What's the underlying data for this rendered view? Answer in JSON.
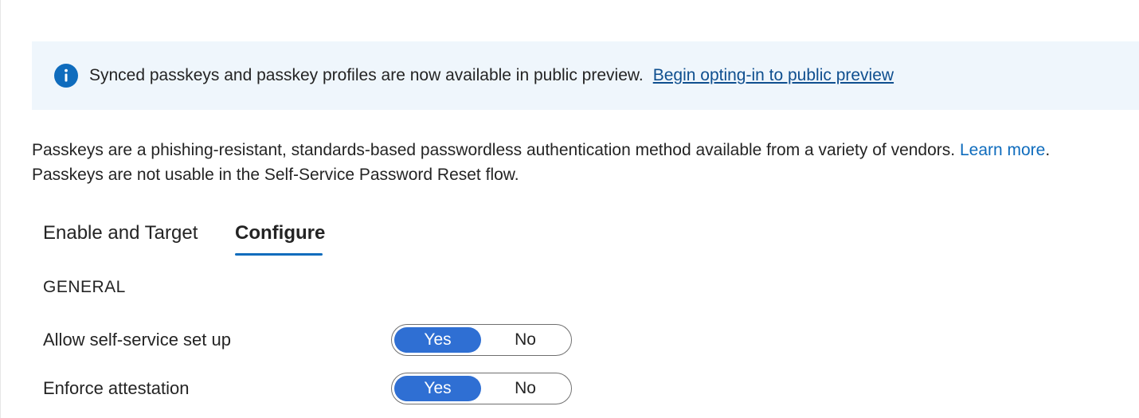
{
  "banner": {
    "icon": "info-icon",
    "message": "Synced passkeys and passkey profiles are now available in public preview.",
    "link_label": "Begin opting-in to public preview"
  },
  "description": {
    "line1": "Passkeys are a phishing-resistant, standards-based passwordless authentication method available from a variety of vendors.",
    "learn_more": "Learn more",
    "line1_end": ".",
    "line2": "Passkeys are not usable in the Self-Service Password Reset flow."
  },
  "tabs": [
    {
      "label": "Enable and Target",
      "selected": false
    },
    {
      "label": "Configure",
      "selected": true
    }
  ],
  "general": {
    "heading": "GENERAL",
    "settings": [
      {
        "label": "Allow self-service set up",
        "on_label": "Yes",
        "off_label": "No",
        "value": "Yes"
      },
      {
        "label": "Enforce attestation",
        "on_label": "Yes",
        "off_label": "No",
        "value": "Yes"
      }
    ]
  },
  "colors": {
    "accent": "#0f6cbd",
    "toggle_selected": "#2f6fd3",
    "banner_background": "#eff6fc"
  }
}
